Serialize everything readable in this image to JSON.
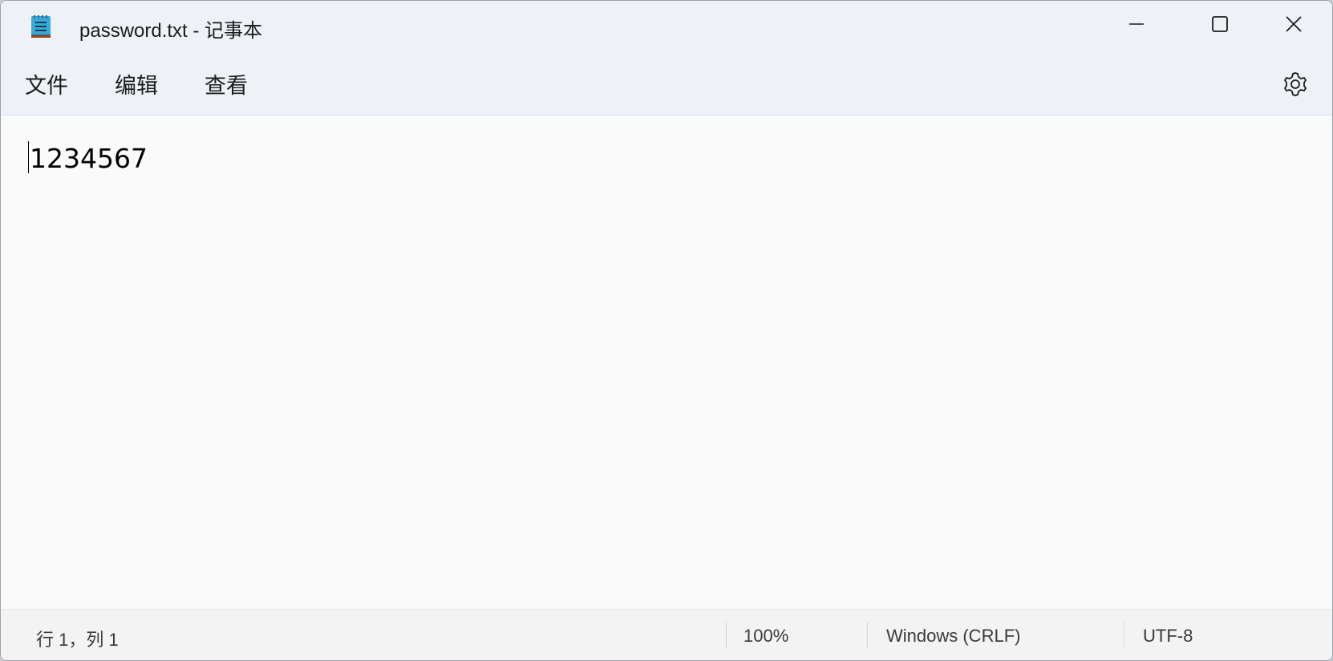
{
  "window": {
    "title": "password.txt - 记事本",
    "icon": "notepad-icon"
  },
  "window_controls": {
    "minimize_icon": "minimize-icon",
    "maximize_icon": "maximize-icon",
    "close_icon": "close-icon"
  },
  "menu": {
    "file": "文件",
    "edit": "编辑",
    "view": "查看",
    "settings_icon": "gear-icon"
  },
  "editor": {
    "content": "1234567"
  },
  "status": {
    "position": "行 1，列 1",
    "zoom": "100%",
    "line_ending": "Windows (CRLF)",
    "encoding": "UTF-8"
  }
}
